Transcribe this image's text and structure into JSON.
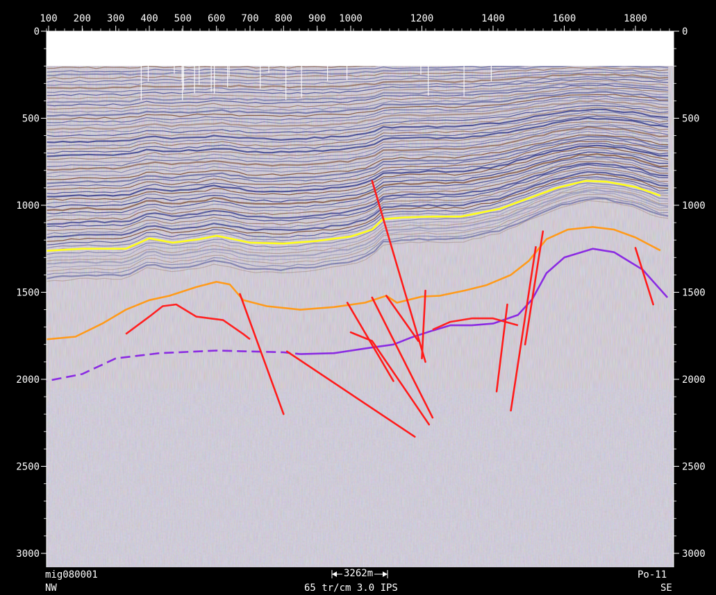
{
  "section": {
    "line_id": "mig080001",
    "scale_bar": "3262m",
    "trace_density": "65 tr/cm 3.0 IPS",
    "profile_name": "Po-11",
    "left_direction": "NW",
    "right_direction": "SE"
  },
  "trace_axis": {
    "ticks": [
      100,
      200,
      300,
      400,
      500,
      600,
      700,
      800,
      900,
      1000,
      1200,
      1400,
      1600,
      1800
    ],
    "range": [
      67,
      1900
    ]
  },
  "time_axis": {
    "ticks": [
      0,
      500,
      1000,
      1500,
      2000,
      2500,
      3000
    ],
    "range": [
      0,
      3080
    ]
  },
  "colors": {
    "background": "#000000",
    "fault": "#ff1a1a",
    "horizon_yellow": "#ffff1a",
    "horizon_orange": "#ff9a1a",
    "horizon_purple": "#8a2be2",
    "horizon_red": "#ff2020",
    "seismic_blue": "#1a237e",
    "seismic_brown": "#6d3a1f"
  },
  "interpretation": {
    "horizons": [
      {
        "id": "yellow",
        "color": "#ffff1a",
        "dashed": false,
        "points": [
          [
            67,
            1265
          ],
          [
            200,
            1250
          ],
          [
            330,
            1250
          ],
          [
            400,
            1190
          ],
          [
            470,
            1215
          ],
          [
            550,
            1195
          ],
          [
            600,
            1175
          ],
          [
            700,
            1215
          ],
          [
            800,
            1220
          ],
          [
            900,
            1205
          ],
          [
            1000,
            1180
          ],
          [
            1060,
            1140
          ],
          [
            1090,
            1080
          ],
          [
            1150,
            1070
          ],
          [
            1230,
            1065
          ],
          [
            1310,
            1065
          ],
          [
            1420,
            1020
          ],
          [
            1500,
            960
          ],
          [
            1580,
            900
          ],
          [
            1660,
            860
          ],
          [
            1720,
            865
          ],
          [
            1800,
            895
          ],
          [
            1870,
            945
          ]
        ]
      },
      {
        "id": "orange",
        "color": "#ff9a1a",
        "dashed": false,
        "points": [
          [
            67,
            1775
          ],
          [
            180,
            1755
          ],
          [
            260,
            1680
          ],
          [
            330,
            1600
          ],
          [
            400,
            1545
          ],
          [
            460,
            1520
          ],
          [
            540,
            1470
          ],
          [
            600,
            1440
          ],
          [
            640,
            1455
          ],
          [
            680,
            1545
          ],
          [
            750,
            1580
          ],
          [
            850,
            1600
          ],
          [
            950,
            1585
          ],
          [
            1040,
            1560
          ],
          [
            1100,
            1520
          ],
          [
            1130,
            1560
          ],
          [
            1200,
            1525
          ],
          [
            1250,
            1520
          ],
          [
            1320,
            1490
          ],
          [
            1380,
            1460
          ],
          [
            1450,
            1400
          ],
          [
            1500,
            1320
          ],
          [
            1550,
            1195
          ],
          [
            1610,
            1140
          ],
          [
            1680,
            1125
          ],
          [
            1740,
            1140
          ],
          [
            1800,
            1185
          ],
          [
            1870,
            1260
          ]
        ]
      },
      {
        "id": "purple-solid",
        "color": "#8a2be2",
        "dashed": false,
        "points": [
          [
            850,
            1855
          ],
          [
            950,
            1850
          ],
          [
            1050,
            1820
          ],
          [
            1120,
            1800
          ],
          [
            1170,
            1760
          ],
          [
            1230,
            1720
          ],
          [
            1280,
            1690
          ],
          [
            1340,
            1690
          ],
          [
            1400,
            1680
          ],
          [
            1470,
            1630
          ],
          [
            1510,
            1540
          ],
          [
            1550,
            1390
          ],
          [
            1600,
            1300
          ],
          [
            1680,
            1250
          ],
          [
            1740,
            1270
          ],
          [
            1820,
            1370
          ],
          [
            1890,
            1530
          ]
        ]
      },
      {
        "id": "purple-dashed",
        "color": "#8a2be2",
        "dashed": true,
        "points": [
          [
            67,
            2020
          ],
          [
            200,
            1970
          ],
          [
            300,
            1880
          ],
          [
            430,
            1850
          ],
          [
            600,
            1835
          ],
          [
            700,
            1840
          ],
          [
            800,
            1845
          ],
          [
            850,
            1855
          ]
        ]
      },
      {
        "id": "red",
        "color": "#ff2020",
        "dashed": false,
        "points": [
          [
            330,
            1740
          ],
          [
            400,
            1640
          ],
          [
            440,
            1580
          ],
          [
            480,
            1570
          ],
          [
            540,
            1640
          ],
          [
            620,
            1660
          ],
          [
            680,
            1740
          ],
          [
            700,
            1770
          ]
        ]
      },
      {
        "id": "red-right",
        "color": "#ff2020",
        "dashed": false,
        "points": [
          [
            1230,
            1715
          ],
          [
            1280,
            1670
          ],
          [
            1340,
            1650
          ],
          [
            1400,
            1650
          ],
          [
            1470,
            1690
          ]
        ]
      }
    ],
    "faults": [
      [
        [
          670,
          1510
        ],
        [
          800,
          2200
        ]
      ],
      [
        [
          1060,
          860
        ],
        [
          1210,
          1900
        ]
      ],
      [
        [
          1100,
          1520
        ],
        [
          1190,
          1780
        ]
      ],
      [
        [
          1210,
          1490
        ],
        [
          1200,
          1880
        ]
      ],
      [
        [
          810,
          1840
        ],
        [
          1180,
          2330
        ]
      ],
      [
        [
          1000,
          1730
        ],
        [
          1060,
          1780
        ],
        [
          1220,
          2260
        ]
      ],
      [
        [
          990,
          1560
        ],
        [
          1120,
          2010
        ]
      ],
      [
        [
          1060,
          1530
        ],
        [
          1230,
          2220
        ]
      ],
      [
        [
          1440,
          1570
        ],
        [
          1410,
          2070
        ]
      ],
      [
        [
          1520,
          1240
        ],
        [
          1450,
          2180
        ]
      ],
      [
        [
          1540,
          1150
        ],
        [
          1490,
          1800
        ]
      ],
      [
        [
          1800,
          1245
        ],
        [
          1850,
          1570
        ]
      ]
    ]
  }
}
